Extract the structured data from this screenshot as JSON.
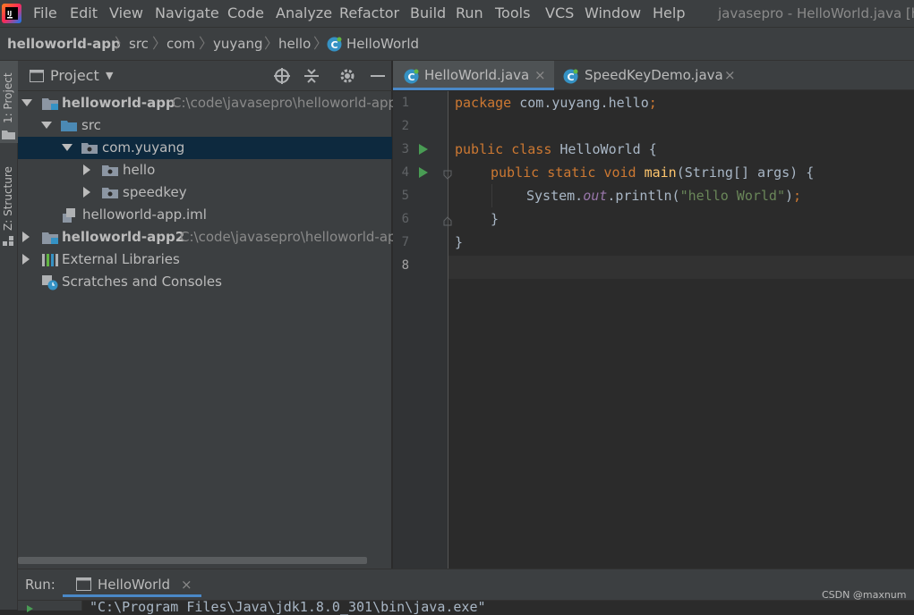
{
  "menubar": {
    "items": [
      {
        "label": "File"
      },
      {
        "label": "Edit"
      },
      {
        "label": "View"
      },
      {
        "label": "Navigate"
      },
      {
        "label": "Code"
      },
      {
        "label": "Analyze"
      },
      {
        "label": "Refactor"
      },
      {
        "label": "Build"
      },
      {
        "label": "Run"
      },
      {
        "label": "Tools"
      },
      {
        "label": "VCS"
      },
      {
        "label": "Window"
      },
      {
        "label": "Help"
      }
    ],
    "window_title": "javasepro - HelloWorld.java [h"
  },
  "breadcrumb": {
    "items": [
      "helloworld-app",
      "src",
      "com",
      "yuyang",
      "hello",
      "HelloWorld"
    ]
  },
  "left_stripe": {
    "project_tab": "1: Project",
    "structure_tab": "Z: Structure"
  },
  "project_panel": {
    "title": "Project",
    "tree": [
      {
        "label": "helloworld-app",
        "path": "C:\\code\\javasepro\\helloworld-app"
      },
      {
        "label": "src"
      },
      {
        "label": "com.yuyang"
      },
      {
        "label": "hello"
      },
      {
        "label": "speedkey"
      },
      {
        "label": "helloworld-app.iml"
      },
      {
        "label": "helloworld-app2",
        "path": "C:\\code\\javasepro\\helloworld-app"
      },
      {
        "label": "External Libraries"
      },
      {
        "label": "Scratches and Consoles"
      }
    ]
  },
  "editor": {
    "tabs": [
      {
        "label": "HelloWorld.java"
      },
      {
        "label": "SpeedKeyDemo.java"
      }
    ],
    "line_numbers": [
      "1",
      "2",
      "3",
      "4",
      "5",
      "6",
      "7",
      "8"
    ],
    "code": {
      "l1_kw": "package",
      "l1_rest": " com.yuyang.hello",
      "l1_semi": ";",
      "l3_kw": "public class",
      "l3_rest": " HelloWorld {",
      "l4_kw": "public static void",
      "l4_fn": "main",
      "l4_rest": "(String[] args) {",
      "l5_a": "System.",
      "l5_out": "out",
      "l5_b": ".println(",
      "l5_str": "\"hello World\"",
      "l5_c": ")",
      "l5_semi": ";",
      "l6": "}",
      "l7": "}"
    }
  },
  "run": {
    "label": "Run:",
    "tab_label": "HelloWorld",
    "console_line": "\"C:\\Program Files\\Java\\jdk1.8.0_301\\bin\\java.exe\""
  },
  "watermark": "CSDN @maxnum",
  "colors": {
    "keyword": "#cc7832",
    "function": "#ffc66d",
    "string": "#6a8759",
    "static_field": "#9876aa",
    "selection": "#0d293e",
    "active_tab_underline": "#4a88c7",
    "run_gutter_icon": "#499c54"
  }
}
